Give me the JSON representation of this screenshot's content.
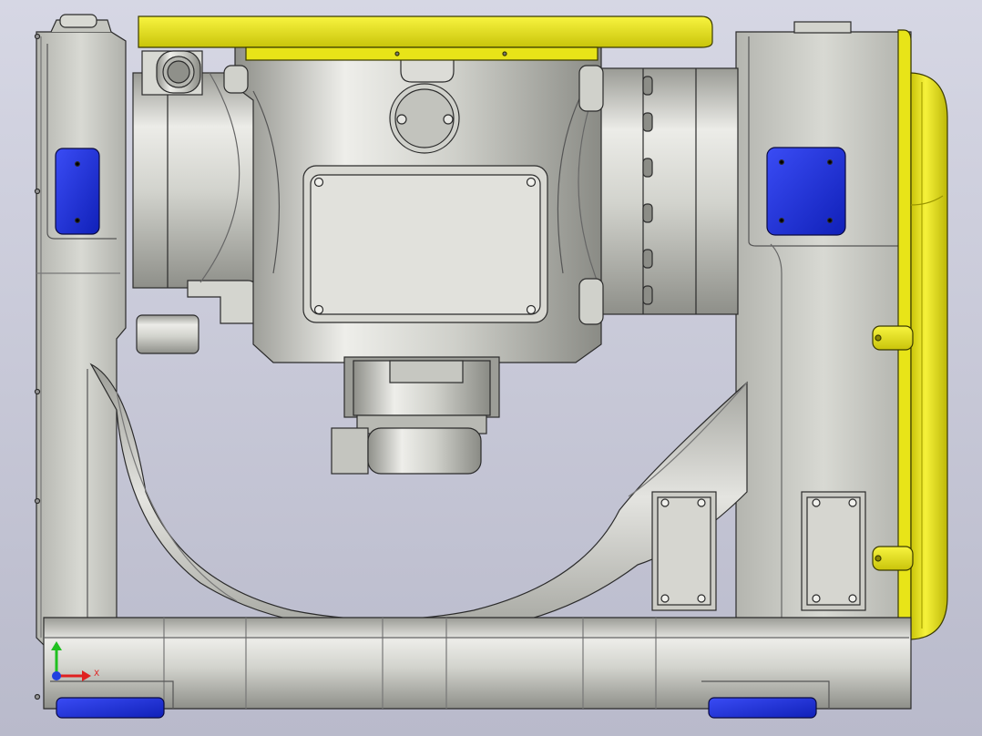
{
  "viewport": {
    "background_top": "#d6d7e4",
    "background_bottom": "#b9bacb",
    "model_colors": {
      "body": "#c9cac4",
      "body_light": "#ecece8",
      "body_dark": "#8f908a",
      "edge": "#2b2b2b",
      "accent_yellow": "#f2ee1c",
      "accent_blue": "#1b2fe0"
    }
  },
  "triad": {
    "x_axis_label": "X",
    "x_color": "#e02020",
    "y_color": "#20c020",
    "z_color": "#2040e0"
  }
}
